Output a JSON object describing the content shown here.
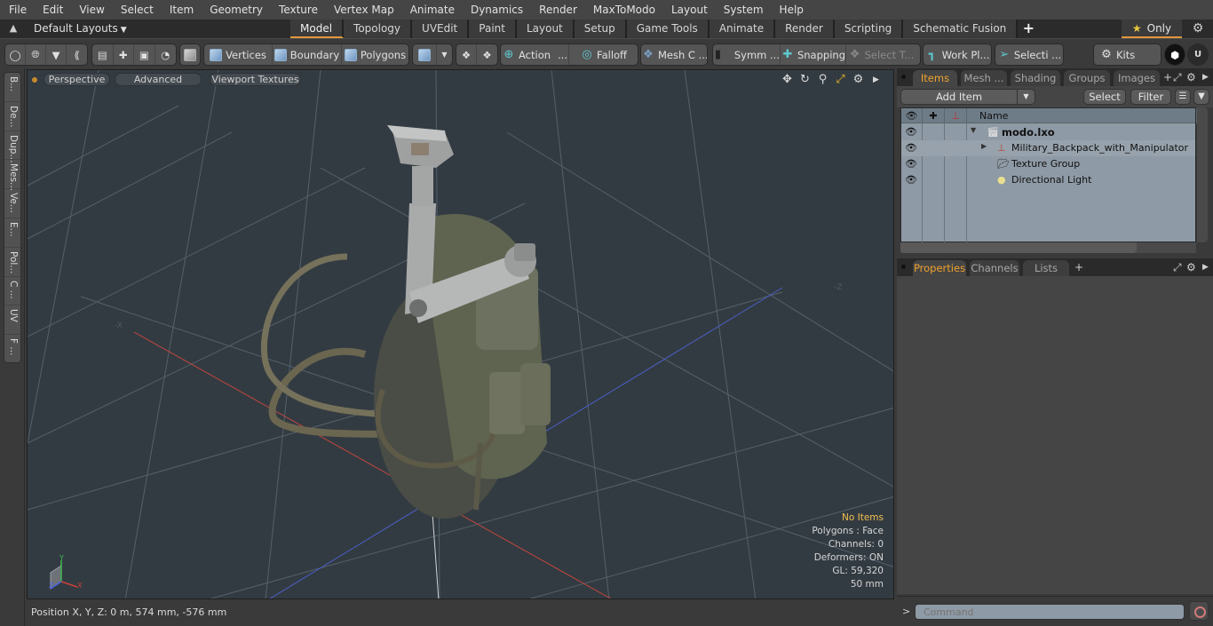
{
  "menu": [
    "File",
    "Edit",
    "View",
    "Select",
    "Item",
    "Geometry",
    "Texture",
    "Vertex Map",
    "Animate",
    "Dynamics",
    "Render",
    "MaxToModo",
    "Layout",
    "System",
    "Help"
  ],
  "layout_bar": {
    "layouts_label": "Default Layouts",
    "tabs": [
      "Model",
      "Topology",
      "UVEdit",
      "Paint",
      "Layout",
      "Setup",
      "Game Tools",
      "Animate",
      "Render",
      "Scripting",
      "Schematic Fusion"
    ],
    "active_tab": "Model",
    "only_label": "Only"
  },
  "toolbar": {
    "vertices": "Vertices",
    "boundary": "Boundary",
    "polygons": "Polygons",
    "action": "Action",
    "action_more": "...",
    "falloff": "Falloff",
    "mesh_c": "Mesh C ...",
    "symm": "Symm ...",
    "snapping": "Snapping",
    "select_t": "Select T...",
    "work_pl": "Work Pl...",
    "selecti": "Selecti ...",
    "kits": "Kits"
  },
  "left_strip": [
    "B...",
    "De...",
    "Dup...",
    "Mes...",
    "Ve...",
    "E...",
    "Pol...",
    "C ...",
    "UV",
    "F ..."
  ],
  "viewport": {
    "view_mode": "Perspective",
    "shading": "Advanced",
    "textures": "Viewport Textures",
    "info": {
      "selection": "No Items",
      "polygons": "Polygons : Face",
      "channels": "Channels: 0",
      "deformers": "Deformers: ON",
      "gl": "GL: 59,320",
      "scale": "50 mm"
    },
    "axis_labels": {
      "x": "X",
      "y": "Y",
      "z": "Z"
    }
  },
  "status": {
    "position": "Position X, Y, Z:   0 m, 574 mm, -576 mm"
  },
  "items_panel": {
    "tabs": [
      "Items",
      "Mesh ...",
      "Shading",
      "Groups",
      "Images"
    ],
    "active_tab": "Items",
    "add_item": "Add Item",
    "select": "Select",
    "filter": "Filter",
    "column_name": "Name",
    "tree": [
      {
        "name": "modo.lxo",
        "level": 0,
        "expanded": true,
        "type": "scene"
      },
      {
        "name": "Military_Backpack_with_Manipulator",
        "level": 1,
        "expanded": false,
        "type": "mesh"
      },
      {
        "name": "Texture Group",
        "level": 1,
        "type": "folder"
      },
      {
        "name": "Directional Light",
        "level": 1,
        "type": "light"
      }
    ]
  },
  "properties_panel": {
    "tabs": [
      "Properties",
      "Channels",
      "Lists"
    ],
    "active_tab": "Properties"
  },
  "command": {
    "prompt": ">",
    "placeholder": "Command"
  }
}
